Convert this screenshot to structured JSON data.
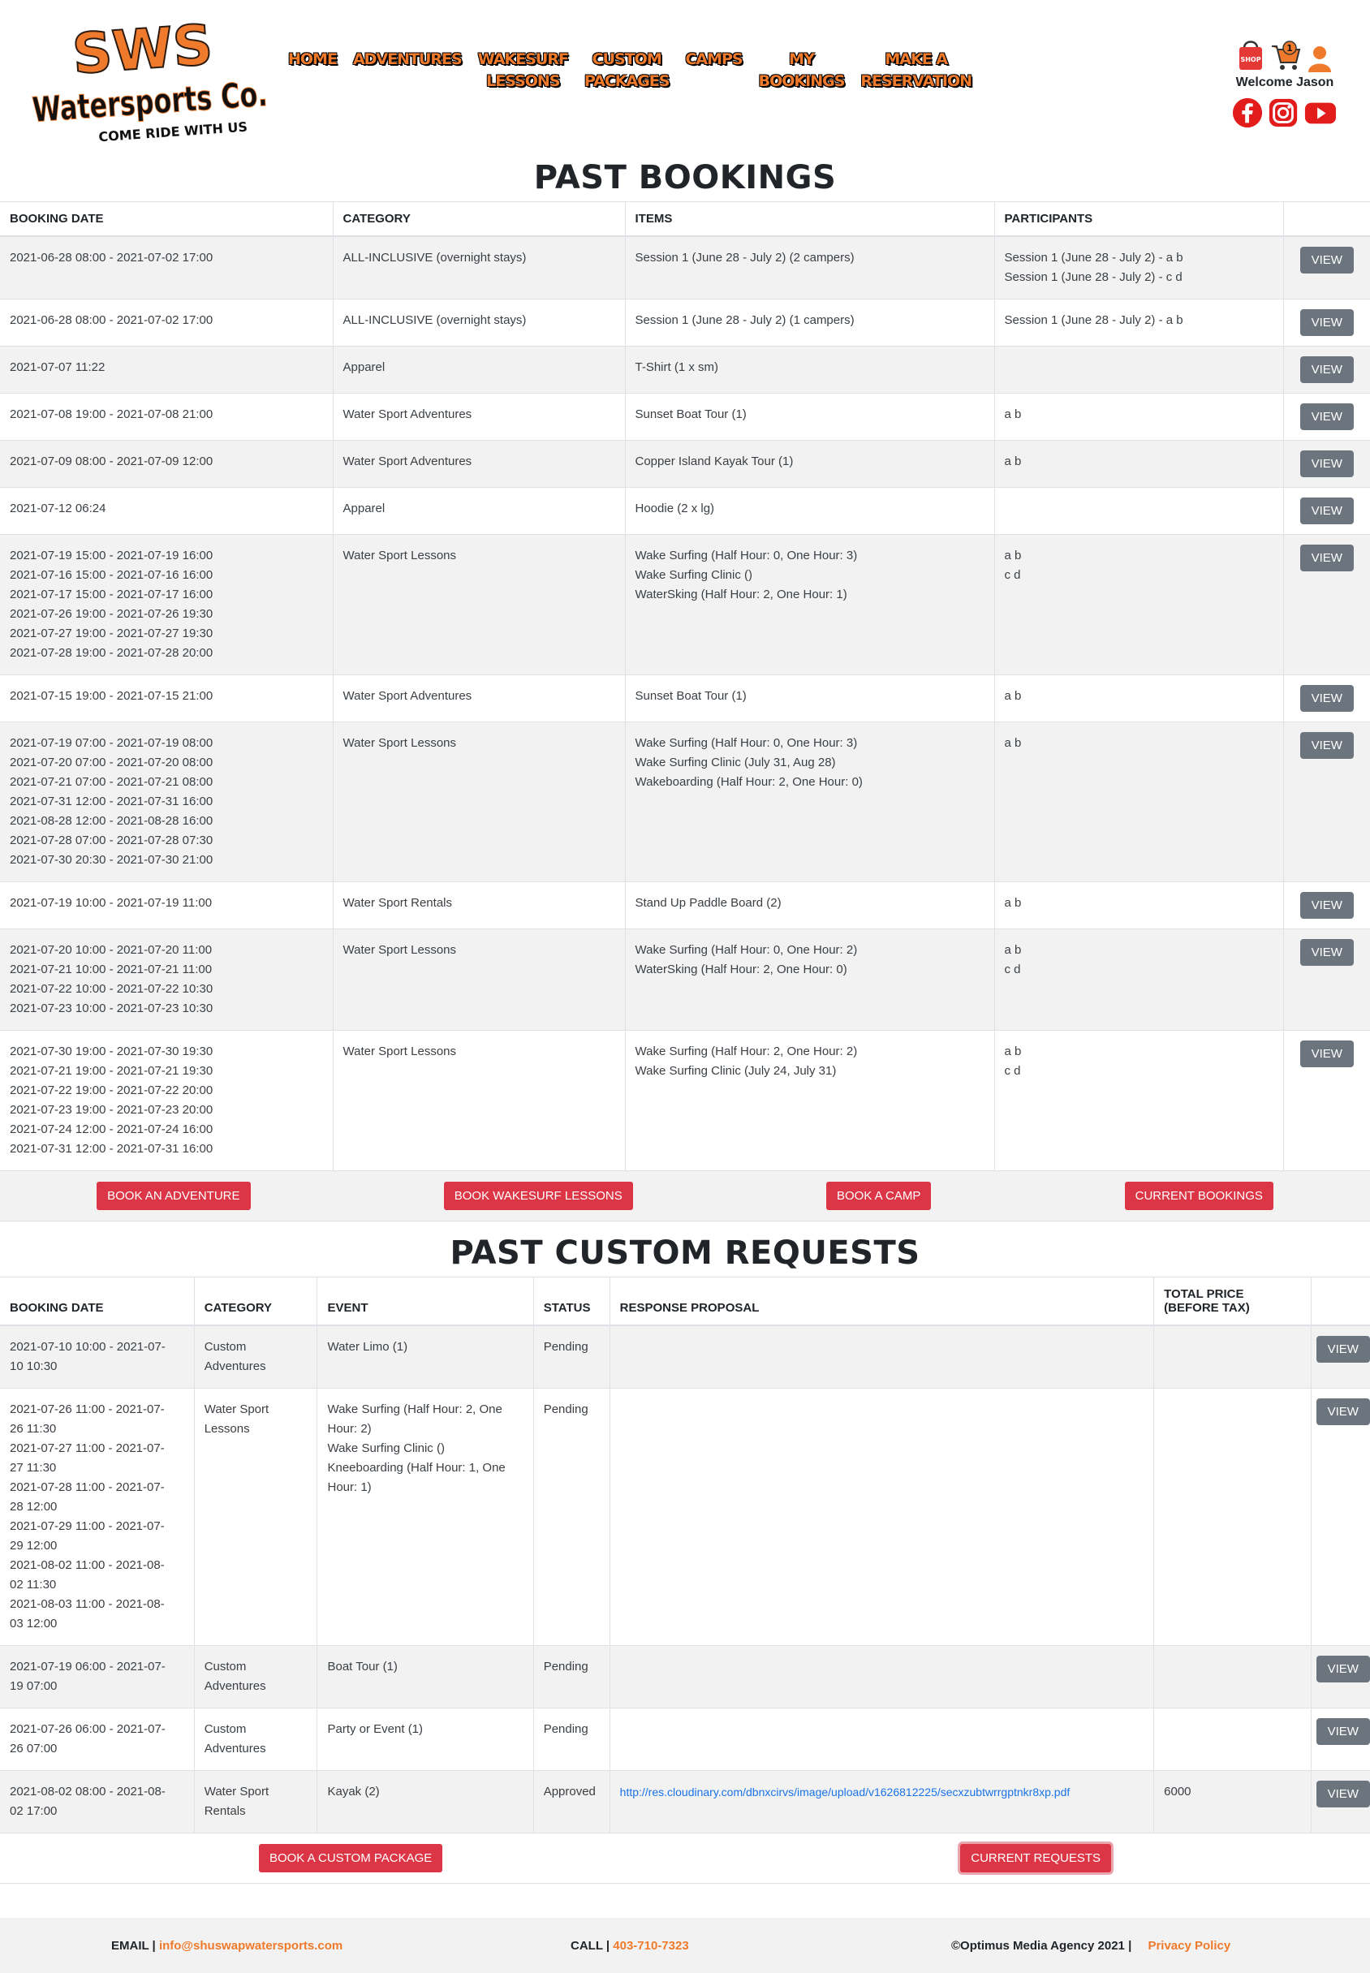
{
  "brand": {
    "logo_text_top": "SWS",
    "logo_text_main": "Watersports Co.",
    "logo_tagline": "COME RIDE WITH US",
    "orange": "#f07a2b"
  },
  "nav": [
    {
      "l1": "HOME",
      "l2": ""
    },
    {
      "l1": "ADVENTURES",
      "l2": ""
    },
    {
      "l1": "WAKESURF",
      "l2": "LESSONS"
    },
    {
      "l1": "CUSTOM",
      "l2": "PACKAGES"
    },
    {
      "l1": "CAMPS",
      "l2": ""
    },
    {
      "l1": "MY",
      "l2": "BOOKINGS"
    },
    {
      "l1": "MAKE A",
      "l2": "RESERVATION"
    }
  ],
  "user": {
    "welcome": "Welcome Jason",
    "shop_label": "SHOP",
    "cart_count": "1"
  },
  "past_bookings": {
    "title": "PAST BOOKINGS",
    "headers": [
      "BOOKING DATE",
      "CATEGORY",
      "ITEMS",
      "PARTICIPANTS",
      ""
    ],
    "rows": [
      {
        "date": "2021-06-28 08:00 - 2021-07-02 17:00",
        "category": "ALL-INCLUSIVE (overnight stays)",
        "items": "Session 1 (June 28 - July 2) (2 campers)",
        "participants": "Session 1 (June 28 - July 2) - a b\nSession 1 (June 28 - July 2) - c d"
      },
      {
        "date": "2021-06-28 08:00 - 2021-07-02 17:00",
        "category": "ALL-INCLUSIVE (overnight stays)",
        "items": "Session 1 (June 28 - July 2) (1 campers)",
        "participants": "Session 1 (June 28 - July 2) - a b"
      },
      {
        "date": "2021-07-07 11:22",
        "category": "Apparel",
        "items": "T-Shirt (1 x sm)",
        "participants": ""
      },
      {
        "date": "2021-07-08 19:00 - 2021-07-08 21:00",
        "category": "Water Sport Adventures",
        "items": "Sunset Boat Tour (1)",
        "participants": "a b"
      },
      {
        "date": "2021-07-09 08:00 - 2021-07-09 12:00",
        "category": "Water Sport Adventures",
        "items": "Copper Island Kayak Tour (1)",
        "participants": "a b"
      },
      {
        "date": "2021-07-12 06:24",
        "category": "Apparel",
        "items": "Hoodie (2 x lg)",
        "participants": ""
      },
      {
        "date": "2021-07-19 15:00 - 2021-07-19 16:00\n2021-07-16 15:00 - 2021-07-16 16:00\n2021-07-17 15:00 - 2021-07-17 16:00\n2021-07-26 19:00 - 2021-07-26 19:30\n2021-07-27 19:00 - 2021-07-27 19:30\n2021-07-28 19:00 - 2021-07-28 20:00",
        "category": "Water Sport Lessons",
        "items": "Wake Surfing (Half Hour: 0, One Hour: 3)\nWake Surfing Clinic ()\nWaterSking (Half Hour: 2, One Hour: 1)",
        "participants": "a b\nc d"
      },
      {
        "date": "2021-07-15 19:00 - 2021-07-15 21:00",
        "category": "Water Sport Adventures",
        "items": "Sunset Boat Tour (1)",
        "participants": "a b"
      },
      {
        "date": "2021-07-19 07:00 - 2021-07-19 08:00\n2021-07-20 07:00 - 2021-07-20 08:00\n2021-07-21 07:00 - 2021-07-21 08:00\n2021-07-31 12:00 - 2021-07-31 16:00\n2021-08-28 12:00 - 2021-08-28 16:00\n2021-07-28 07:00 - 2021-07-28 07:30\n2021-07-30 20:30 - 2021-07-30 21:00",
        "category": "Water Sport Lessons",
        "items": "Wake Surfing (Half Hour: 0, One Hour: 3)\nWake Surfing Clinic (July 31, Aug 28)\nWakeboarding (Half Hour: 2, One Hour: 0)",
        "participants": "a b"
      },
      {
        "date": "2021-07-19 10:00 - 2021-07-19 11:00",
        "category": "Water Sport Rentals",
        "items": "Stand Up Paddle Board (2)",
        "participants": "a b"
      },
      {
        "date": "2021-07-20 10:00 - 2021-07-20 11:00\n2021-07-21 10:00 - 2021-07-21 11:00\n2021-07-22 10:00 - 2021-07-22 10:30\n2021-07-23 10:00 - 2021-07-23 10:30",
        "category": "Water Sport Lessons",
        "items": "Wake Surfing (Half Hour: 0, One Hour: 2)\nWaterSking (Half Hour: 2, One Hour: 0)",
        "participants": "a b\nc d"
      },
      {
        "date": "2021-07-30 19:00 - 2021-07-30 19:30\n2021-07-21 19:00 - 2021-07-21 19:30\n2021-07-22 19:00 - 2021-07-22 20:00\n2021-07-23 19:00 - 2021-07-23 20:00\n2021-07-24 12:00 - 2021-07-24 16:00\n2021-07-31 12:00 - 2021-07-31 16:00",
        "category": "Water Sport Lessons",
        "items": "Wake Surfing (Half Hour: 2, One Hour: 2)\nWake Surfing Clinic (July 24, July 31)",
        "participants": "a b\nc d"
      }
    ],
    "view_label": "VIEW",
    "actions": [
      "BOOK AN ADVENTURE",
      "BOOK WAKESURF LESSONS",
      "BOOK A CAMP",
      "CURRENT BOOKINGS"
    ]
  },
  "past_custom": {
    "title": "PAST CUSTOM REQUESTS",
    "headers": [
      "BOOKING DATE",
      "CATEGORY",
      "EVENT",
      "STATUS",
      "RESPONSE PROPOSAL",
      "TOTAL PRICE (BEFORE TAX)",
      ""
    ],
    "rows": [
      {
        "date": "2021-07-10 10:00 - 2021-07-\n10 10:30",
        "category": "Custom\nAdventures",
        "event": "Water Limo (1)",
        "status": "Pending",
        "proposal": "",
        "price": ""
      },
      {
        "date": "2021-07-26 11:00 - 2021-07-\n26 11:30\n2021-07-27 11:00 - 2021-07-\n27 11:30\n2021-07-28 11:00 - 2021-07-\n28 12:00\n2021-07-29 11:00 - 2021-07-\n29 12:00\n2021-08-02 11:00 - 2021-08-\n02 11:30\n2021-08-03 11:00 - 2021-08-\n03 12:00",
        "category": "Water Sport\nLessons",
        "event": "Wake Surfing (Half Hour: 2, One\nHour: 2)\nWake Surfing Clinic ()\nKneeboarding (Half Hour: 1, One\nHour: 1)",
        "status": "Pending",
        "proposal": "",
        "price": ""
      },
      {
        "date": "2021-07-19 06:00 - 2021-07-\n19 07:00",
        "category": "Custom\nAdventures",
        "event": "Boat Tour (1)",
        "status": "Pending",
        "proposal": "",
        "price": ""
      },
      {
        "date": "2021-07-26 06:00 - 2021-07-\n26 07:00",
        "category": "Custom\nAdventures",
        "event": "Party or Event (1)",
        "status": "Pending",
        "proposal": "",
        "price": ""
      },
      {
        "date": "2021-08-02 08:00 - 2021-08-\n02 17:00",
        "category": "Water Sport\nRentals",
        "event": "Kayak (2)",
        "status": "Approved",
        "proposal": "http://res.cloudinary.com/dbnxcirvs/image/upload/v1626812225/secxzubtwrrgptnkr8xp.pdf",
        "price": "6000"
      }
    ],
    "view_label": "VIEW",
    "actions": [
      "BOOK A CUSTOM PACKAGE",
      "CURRENT REQUESTS"
    ]
  },
  "footer": {
    "email_label": "EMAIL |",
    "email": "info@shuswapwatersports.com",
    "call_label": "CALL |",
    "phone": "403-710-7323",
    "copyright": "©Optimus Media Agency 2021 |",
    "privacy": "Privacy Policy"
  }
}
